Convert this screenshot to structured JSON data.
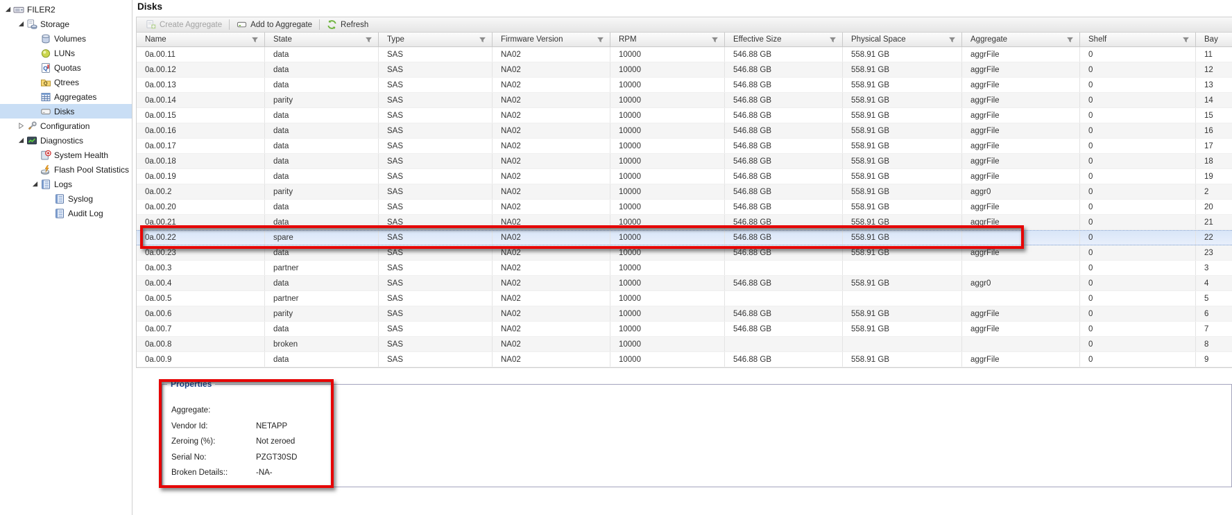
{
  "page": {
    "title": "Disks"
  },
  "sidebar": {
    "items": [
      {
        "label": "FILER2",
        "level": 0,
        "expander": "expanded",
        "icon": "filer-icon",
        "selected": false
      },
      {
        "label": "Storage",
        "level": 1,
        "expander": "expanded",
        "icon": "storage-icon",
        "selected": false
      },
      {
        "label": "Volumes",
        "level": 2,
        "expander": "none",
        "icon": "volumes-icon",
        "selected": false
      },
      {
        "label": "LUNs",
        "level": 2,
        "expander": "none",
        "icon": "luns-icon",
        "selected": false
      },
      {
        "label": "Quotas",
        "level": 2,
        "expander": "none",
        "icon": "quotas-icon",
        "selected": false
      },
      {
        "label": "Qtrees",
        "level": 2,
        "expander": "none",
        "icon": "qtrees-icon",
        "selected": false
      },
      {
        "label": "Aggregates",
        "level": 2,
        "expander": "none",
        "icon": "aggregates-icon",
        "selected": false
      },
      {
        "label": "Disks",
        "level": 2,
        "expander": "none",
        "icon": "disks-icon",
        "selected": true
      },
      {
        "label": "Configuration",
        "level": 1,
        "expander": "collapsed",
        "icon": "configuration-icon",
        "selected": false
      },
      {
        "label": "Diagnostics",
        "level": 1,
        "expander": "expanded",
        "icon": "diagnostics-icon",
        "selected": false
      },
      {
        "label": "System Health",
        "level": 2,
        "expander": "none",
        "icon": "system-health-icon",
        "selected": false
      },
      {
        "label": "Flash Pool Statistics",
        "level": 2,
        "expander": "none",
        "icon": "flash-pool-icon",
        "selected": false
      },
      {
        "label": "Logs",
        "level": 2,
        "expander": "expanded",
        "icon": "logs-icon",
        "selected": false
      },
      {
        "label": "Syslog",
        "level": 3,
        "expander": "none",
        "icon": "syslog-icon",
        "selected": false
      },
      {
        "label": "Audit Log",
        "level": 3,
        "expander": "none",
        "icon": "audit-log-icon",
        "selected": false
      }
    ]
  },
  "toolbar": {
    "create_aggregate_label": "Create Aggregate",
    "add_to_aggregate_label": "Add to Aggregate",
    "refresh_label": "Refresh"
  },
  "table": {
    "columns": [
      "Name",
      "State",
      "Type",
      "Firmware Version",
      "RPM",
      "Effective Size",
      "Physical Space",
      "Aggregate",
      "Shelf",
      "Bay"
    ],
    "selected_row_name": "0a.00.22",
    "rows": [
      [
        "0a.00.11",
        "data",
        "SAS",
        "NA02",
        "10000",
        "546.88 GB",
        "558.91 GB",
        "aggrFile",
        "0",
        "11"
      ],
      [
        "0a.00.12",
        "data",
        "SAS",
        "NA02",
        "10000",
        "546.88 GB",
        "558.91 GB",
        "aggrFile",
        "0",
        "12"
      ],
      [
        "0a.00.13",
        "data",
        "SAS",
        "NA02",
        "10000",
        "546.88 GB",
        "558.91 GB",
        "aggrFile",
        "0",
        "13"
      ],
      [
        "0a.00.14",
        "parity",
        "SAS",
        "NA02",
        "10000",
        "546.88 GB",
        "558.91 GB",
        "aggrFile",
        "0",
        "14"
      ],
      [
        "0a.00.15",
        "data",
        "SAS",
        "NA02",
        "10000",
        "546.88 GB",
        "558.91 GB",
        "aggrFile",
        "0",
        "15"
      ],
      [
        "0a.00.16",
        "data",
        "SAS",
        "NA02",
        "10000",
        "546.88 GB",
        "558.91 GB",
        "aggrFile",
        "0",
        "16"
      ],
      [
        "0a.00.17",
        "data",
        "SAS",
        "NA02",
        "10000",
        "546.88 GB",
        "558.91 GB",
        "aggrFile",
        "0",
        "17"
      ],
      [
        "0a.00.18",
        "data",
        "SAS",
        "NA02",
        "10000",
        "546.88 GB",
        "558.91 GB",
        "aggrFile",
        "0",
        "18"
      ],
      [
        "0a.00.19",
        "data",
        "SAS",
        "NA02",
        "10000",
        "546.88 GB",
        "558.91 GB",
        "aggrFile",
        "0",
        "19"
      ],
      [
        "0a.00.2",
        "parity",
        "SAS",
        "NA02",
        "10000",
        "546.88 GB",
        "558.91 GB",
        "aggr0",
        "0",
        "2"
      ],
      [
        "0a.00.20",
        "data",
        "SAS",
        "NA02",
        "10000",
        "546.88 GB",
        "558.91 GB",
        "aggrFile",
        "0",
        "20"
      ],
      [
        "0a.00.21",
        "data",
        "SAS",
        "NA02",
        "10000",
        "546.88 GB",
        "558.91 GB",
        "aggrFile",
        "0",
        "21"
      ],
      [
        "0a.00.22",
        "spare",
        "SAS",
        "NA02",
        "10000",
        "546.88 GB",
        "558.91 GB",
        "",
        "0",
        "22"
      ],
      [
        "0a.00.23",
        "data",
        "SAS",
        "NA02",
        "10000",
        "546.88 GB",
        "558.91 GB",
        "aggrFile",
        "0",
        "23"
      ],
      [
        "0a.00.3",
        "partner",
        "SAS",
        "NA02",
        "10000",
        "",
        "",
        "",
        "0",
        "3"
      ],
      [
        "0a.00.4",
        "data",
        "SAS",
        "NA02",
        "10000",
        "546.88 GB",
        "558.91 GB",
        "aggr0",
        "0",
        "4"
      ],
      [
        "0a.00.5",
        "partner",
        "SAS",
        "NA02",
        "10000",
        "",
        "",
        "",
        "0",
        "5"
      ],
      [
        "0a.00.6",
        "parity",
        "SAS",
        "NA02",
        "10000",
        "546.88 GB",
        "558.91 GB",
        "aggrFile",
        "0",
        "6"
      ],
      [
        "0a.00.7",
        "data",
        "SAS",
        "NA02",
        "10000",
        "546.88 GB",
        "558.91 GB",
        "aggrFile",
        "0",
        "7"
      ],
      [
        "0a.00.8",
        "broken",
        "SAS",
        "NA02",
        "10000",
        "",
        "",
        "",
        "0",
        "8"
      ],
      [
        "0a.00.9",
        "data",
        "SAS",
        "NA02",
        "10000",
        "546.88 GB",
        "558.91 GB",
        "aggrFile",
        "0",
        "9"
      ]
    ]
  },
  "properties": {
    "title": "Properties",
    "fields": [
      {
        "label": "Aggregate:",
        "value": ""
      },
      {
        "label": "Vendor Id:",
        "value": "NETAPP"
      },
      {
        "label": "Zeroing (%):",
        "value": "Not zeroed"
      },
      {
        "label": "Serial No:",
        "value": "PZGT30SD"
      },
      {
        "label": "Broken Details::",
        "value": "-NA-"
      }
    ]
  },
  "annotations": {
    "highlight_color": "#e60505",
    "boxes": [
      "selected-disk-row",
      "properties-panel"
    ]
  },
  "colors": {
    "selection_row_bg": "#d9e6f8",
    "sidebar_selected_bg": "#c9def5",
    "accent_green": "#6fb43f",
    "props_title_blue": "#16408c"
  }
}
